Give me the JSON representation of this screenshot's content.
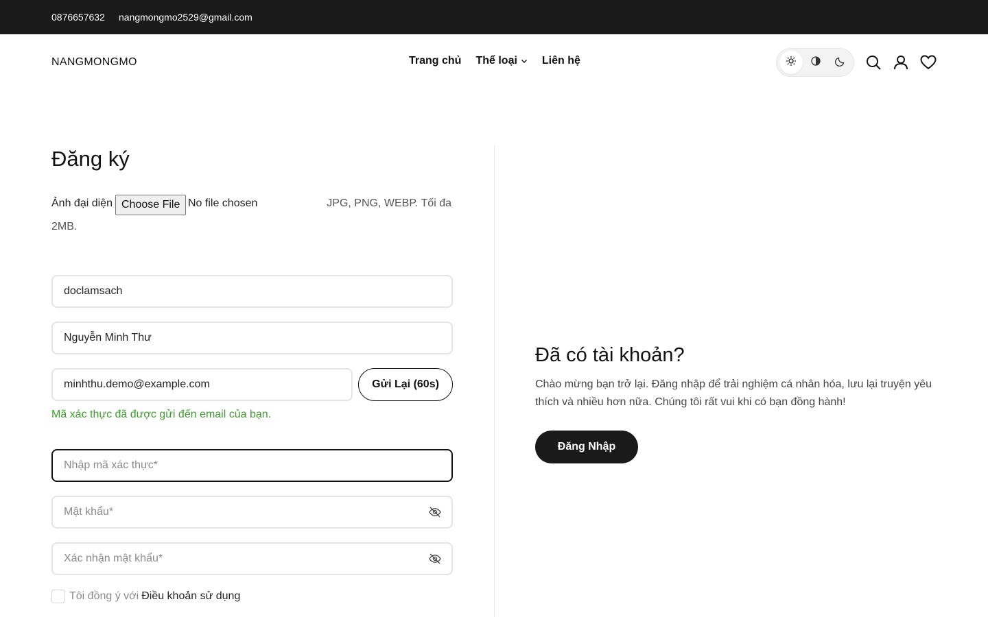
{
  "topbar": {
    "phone": "0876657632",
    "email": "nangmongmo2529@gmail.com"
  },
  "header": {
    "logo": "NANGMONGMO",
    "nav": [
      {
        "label": "Trang chủ"
      },
      {
        "label": "Thể loại",
        "has_dropdown": true
      },
      {
        "label": "Liên hệ"
      }
    ],
    "theme_options": [
      "sun-icon",
      "contrast-icon",
      "moon-icon"
    ],
    "theme_selected": "sun-icon",
    "icons": [
      "search-icon",
      "user-icon",
      "heart-icon"
    ]
  },
  "register": {
    "title": "Đăng ký",
    "avatar_label": "Ảnh đại diện",
    "file_button": "Choose File",
    "file_status": "No file chosen",
    "file_hint": "JPG, PNG, WEBP. Tối đa",
    "file_hint_cont": "2MB.",
    "username": "doclamsach",
    "fullname": "Nguyễn Minh Thư",
    "email": "minhthu.demo@example.com",
    "resend_button": "Gửi Lại (60s)",
    "verify_message": "Mã xác thực đã được gửi đến email của bạn.",
    "code_placeholder": "Nhập mã xác thực*",
    "password_placeholder": "Mật khẩu*",
    "confirm_placeholder": "Xác nhận mật khẩu*",
    "terms_text": "Tôi đồng ý với",
    "terms_link": "Điều khoản sử dụng"
  },
  "login_panel": {
    "title": "Đã có tài khoản?",
    "description": "Chào mừng bạn trở lại. Đăng nhập để trải nghiệm cá nhân hóa, lưu lại truyện yêu thích và nhiều hơn nữa. Chúng tôi rất vui khi có bạn đồng hành!",
    "button": "Đăng Nhập"
  },
  "colors": {
    "topbar_bg": "#1a1a1a",
    "success": "#3f9b2f",
    "primary_button": "#1a1a1a"
  }
}
